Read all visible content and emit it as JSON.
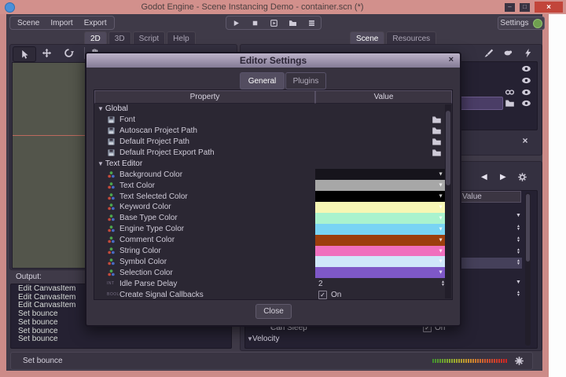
{
  "glyphs": {
    "dropdown": "▼",
    "up": "▲",
    "back": "◀",
    "forward": "▶",
    "check": "✓",
    "close": "×",
    "minimize": "–",
    "maximize": "□"
  },
  "window": {
    "title": "Godot Engine - Scene Instancing Demo - container.scn (*)"
  },
  "menubar": {
    "items": [
      "Scene",
      "Import",
      "Export"
    ],
    "settings": "Settings"
  },
  "workspace_tabs": [
    "2D",
    "3D",
    "Script",
    "Help"
  ],
  "workspace_active": "2D",
  "dock_tabs": [
    "Scene",
    "Resources"
  ],
  "dock_active": "Scene",
  "inspector": {
    "value_header": "Value",
    "can_sleep_label": "Can Sleep",
    "can_sleep_value": "On",
    "velocity_label": "Velocity"
  },
  "output": {
    "title": "Output:",
    "lines": [
      "Edit CanvasItem",
      "Edit CanvasItem",
      "Edit CanvasItem",
      "Set bounce",
      "Set bounce",
      "Set bounce",
      "Set bounce"
    ],
    "status": "Set bounce"
  },
  "dialog": {
    "title": "Editor Settings",
    "tabs": [
      "General",
      "Plugins"
    ],
    "active_tab": "General",
    "property_header": "Property",
    "value_header": "Value",
    "close": "Close",
    "type_badges": {
      "int": "INT",
      "bool": "BOOL"
    },
    "rows": [
      {
        "kind": "category",
        "label": "Global"
      },
      {
        "kind": "resource",
        "label": "Font"
      },
      {
        "kind": "resource",
        "label": "Autoscan Project Path"
      },
      {
        "kind": "resource",
        "label": "Default Project Path"
      },
      {
        "kind": "resource",
        "label": "Default Project Export Path"
      },
      {
        "kind": "category",
        "label": "Text Editor"
      },
      {
        "kind": "color",
        "label": "Background Color",
        "swatch": "#16141c"
      },
      {
        "kind": "color",
        "label": "Text Color",
        "swatch": "#a7a7a7"
      },
      {
        "kind": "color",
        "label": "Text Selected Color",
        "swatch": "#000000"
      },
      {
        "kind": "color",
        "label": "Keyword Color",
        "swatch": "#f7f7b4"
      },
      {
        "kind": "color",
        "label": "Base Type Color",
        "swatch": "#aaf3ce"
      },
      {
        "kind": "color",
        "label": "Engine Type Color",
        "swatch": "#79d4f4"
      },
      {
        "kind": "color",
        "label": "Comment Color",
        "swatch": "#9c3e0d"
      },
      {
        "kind": "color",
        "label": "String Color",
        "swatch": "#f06fbe"
      },
      {
        "kind": "color",
        "label": "Symbol Color",
        "swatch": "#cfe7fa"
      },
      {
        "kind": "color",
        "label": "Selection Color",
        "swatch": "#7e58c7"
      },
      {
        "kind": "int",
        "label": "Idle Parse Delay",
        "value": "2"
      },
      {
        "kind": "bool",
        "label": "Create Signal Callbacks",
        "value": "On"
      }
    ]
  }
}
